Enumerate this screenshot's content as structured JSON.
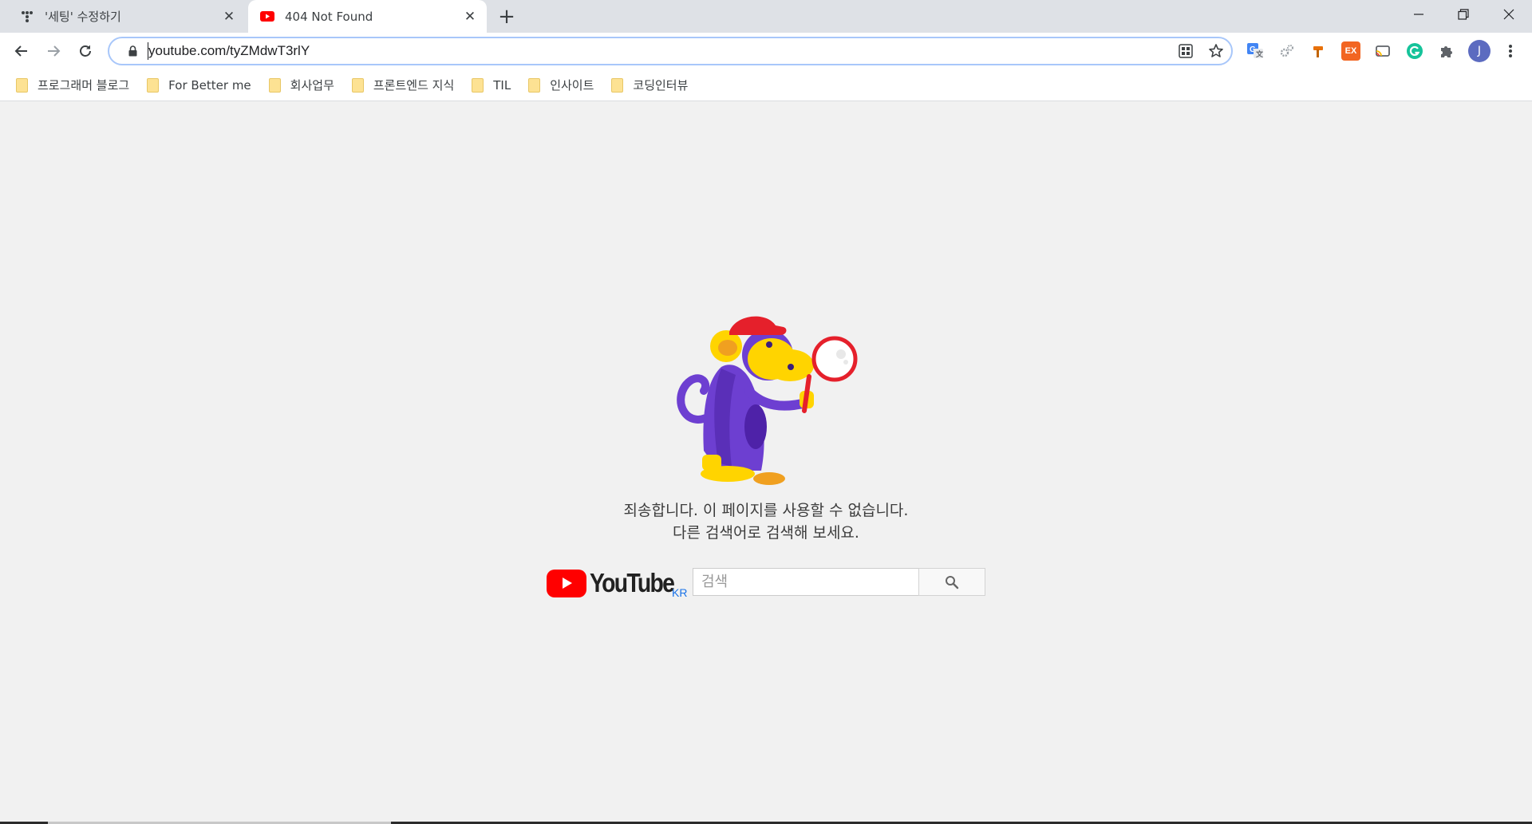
{
  "tabs": [
    {
      "title": "'세팅' 수정하기",
      "favicon": "tistory-dots-icon",
      "active": false
    },
    {
      "title": "404 Not Found",
      "favicon": "youtube-icon",
      "active": true
    }
  ],
  "toolbar": {
    "url": "youtube.com/tyZMdwT3rlY"
  },
  "extensions": [
    {
      "name": "google-translate-icon",
      "label": "",
      "color": "#4285f4"
    },
    {
      "name": "settings-gears-icon",
      "label": "",
      "color": "#9aa0a6"
    },
    {
      "name": "hammer-icon",
      "label": "",
      "color": "#e8710a"
    },
    {
      "name": "ex-extension-icon",
      "label": "EX",
      "color": "#f26522"
    },
    {
      "name": "cast-icon",
      "label": "",
      "color": "#5f6368"
    },
    {
      "name": "grammarly-icon",
      "label": "",
      "color": "#15c39a"
    },
    {
      "name": "puzzle-icon",
      "label": "",
      "color": "#5f6368"
    }
  ],
  "profile": {
    "initial": "J",
    "color": "#5c6bc0"
  },
  "bookmarks": [
    "프로그래머 블로그",
    "For Better me",
    "회사업무",
    "프론트엔드 지식",
    "TIL",
    "인사이트",
    "코딩인터뷰"
  ],
  "page": {
    "line1": "죄송합니다. 이 페이지를 사용할 수 없습니다.",
    "line2": "다른 검색어로 검색해 보세요.",
    "logo_text": "YouTube",
    "country": "KR",
    "search_placeholder": "검색"
  },
  "colors": {
    "youtube_red": "#ff0000",
    "monkey_purple": "#6d3fd1",
    "monkey_yellow": "#ffd400"
  }
}
